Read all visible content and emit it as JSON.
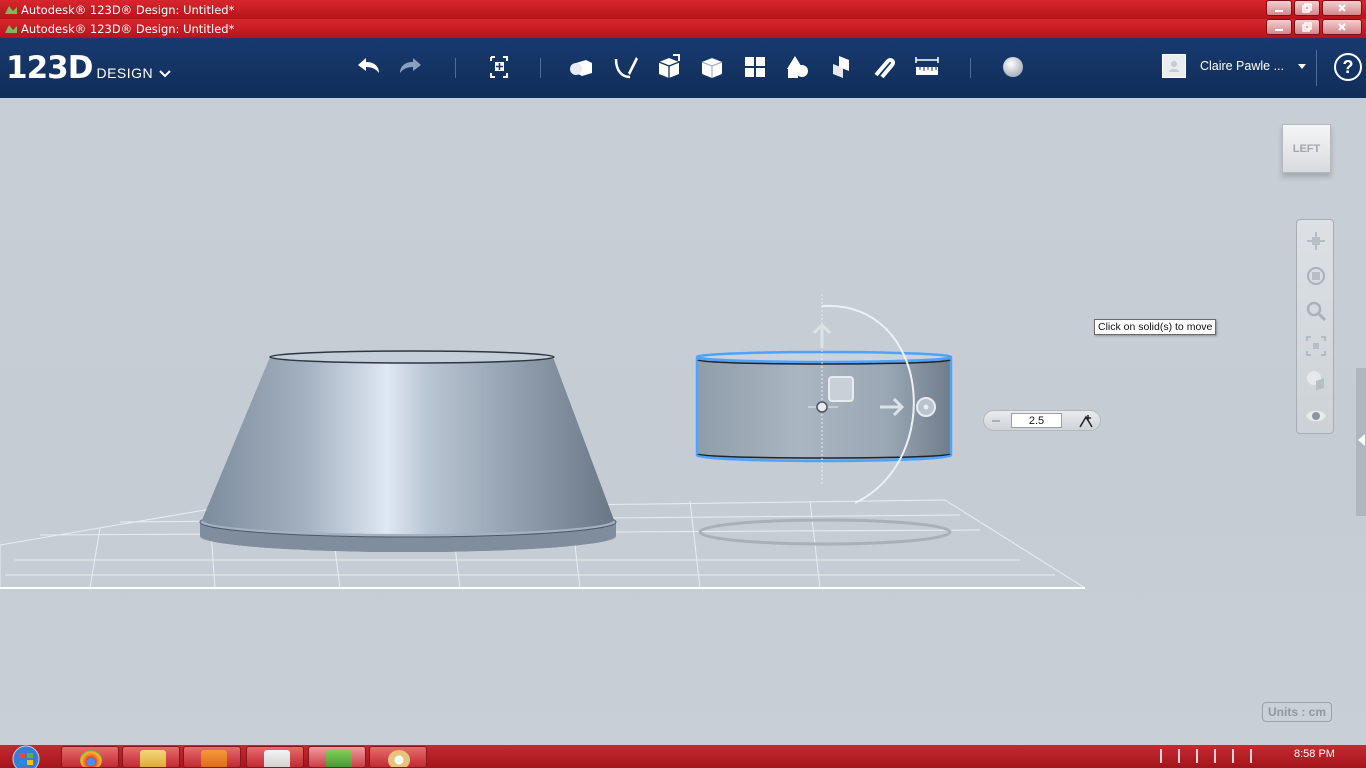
{
  "windows": [
    {
      "title": "Autodesk® 123D® Design: Untitled*"
    },
    {
      "title": "Autodesk® 123D® Design: Untitled*"
    }
  ],
  "toolbar": {
    "logo_big": "123D",
    "logo_small": "DESIGN",
    "user_name": "Claire Pawle ...",
    "help_label": "?",
    "tools": [
      "undo-icon",
      "redo-icon",
      "transform-icon",
      "primitives-icon",
      "sketch-icon",
      "construct-icon",
      "modify-icon",
      "pattern-icon",
      "grouping-icon",
      "combine-icon",
      "snap-icon",
      "measure-icon",
      "material-icon"
    ]
  },
  "viewport": {
    "viewcube_label": "LEFT",
    "tooltip": "Click on solid(s) to move",
    "move_value": "2.5",
    "units_label": "Units : cm"
  },
  "taskbar": {
    "clock": "8:58 PM",
    "items": [
      "chrome",
      "explorer",
      "media-player",
      "acrobat",
      "123d-design",
      "paint"
    ]
  },
  "colors": {
    "titlebar": "#c41f27",
    "toolbar": "#14335f",
    "viewport": "#c5ccd4",
    "selection": "#4da3ff"
  }
}
